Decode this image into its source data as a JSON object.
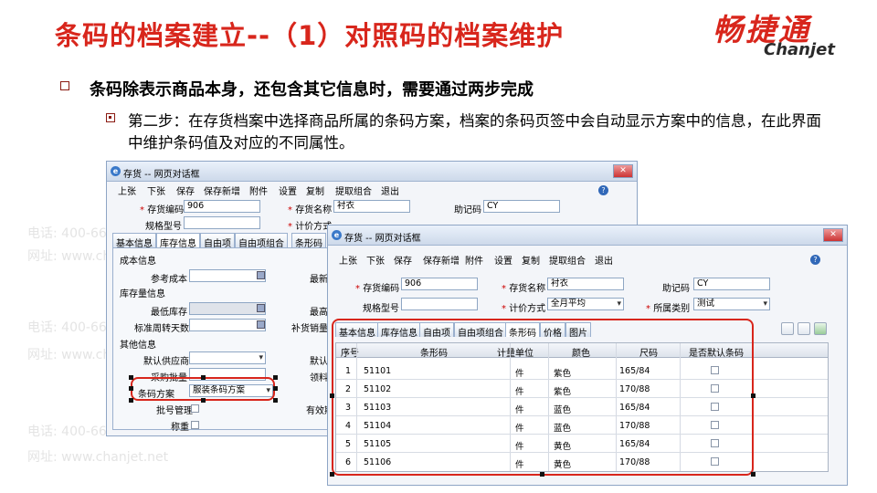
{
  "slide": {
    "title": "条码的档案建立--（1）对照码的档案维护",
    "bullet1": "条码除表示商品本身，还包含其它信息时，需要通过两步完成",
    "bullet2": "第二步：在存货档案中选择商品所属的条码方案，档案的条码页签中会自动显示方案中的信息，在此界面中维护条码值及对应的不同属性。"
  },
  "logo": {
    "cn": "畅捷通",
    "en": "Chanjet"
  },
  "watermark": {
    "phone": "电话: 400-665-0028",
    "web": "网址: www.chanjet.net"
  },
  "colors": {
    "accent": "#d8261c",
    "window_border": "#8ea5c5"
  },
  "back_window": {
    "title": "存货 -- 网页对话框",
    "menu": [
      "上张",
      "下张",
      "保存",
      "保存新增",
      "附件",
      "设置",
      "复制",
      "提取组合",
      "退出"
    ],
    "fields": {
      "code_label": "存货编码",
      "code_value": "906",
      "name_label": "存货名称",
      "name_value": "衬衣",
      "mnemonic_label": "助记码",
      "mnemonic_value": "CY",
      "spec_label": "规格型号",
      "unit_label": "计价方式"
    },
    "tabs": [
      "基本信息",
      "库存信息",
      "自由项",
      "自由项组合",
      "条形码"
    ],
    "sections": {
      "cost": "成本信息",
      "stock": "库存量信息",
      "other": "其他信息"
    },
    "labels": {
      "ref_cost": "参考成本",
      "latest": "最新",
      "min_stock": "最低库存",
      "max": "最高",
      "turnover": "标准周转天数",
      "supplement": "补货销量",
      "supplier": "默认供应商",
      "default_wh": "默认",
      "purchase_batch": "采购批量",
      "lead": "领料",
      "barcode_scheme": "条码方案",
      "barcode_scheme_value": "服装条码方案",
      "batch_mgmt": "批号管理",
      "expiry": "有效期",
      "weighing": "称重"
    }
  },
  "front_window": {
    "title": "存货 -- 网页对话框",
    "menu": [
      "上张",
      "下张",
      "保存",
      "保存新增",
      "附件",
      "设置",
      "复制",
      "提取组合",
      "退出"
    ],
    "fields": {
      "code_label": "存货编码",
      "code_value": "906",
      "name_label": "存货名称",
      "name_value": "衬衣",
      "mnemonic_label": "助记码",
      "mnemonic_value": "CY",
      "spec_label": "规格型号",
      "pricing_label": "计价方式",
      "pricing_value": "全月平均",
      "category_label": "所属类别",
      "category_value": "测试"
    },
    "tabs": [
      "基本信息",
      "库存信息",
      "自由项",
      "自由项组合",
      "条形码",
      "价格",
      "图片"
    ],
    "table": {
      "columns": [
        "序号",
        "条形码",
        "计量单位",
        "颜色",
        "尺码",
        "是否默认条码"
      ],
      "rows": [
        {
          "no": "1",
          "barcode": "51101",
          "unit": "件",
          "color": "紫色",
          "size": "165/84",
          "default": false
        },
        {
          "no": "2",
          "barcode": "51102",
          "unit": "件",
          "color": "紫色",
          "size": "170/88",
          "default": false
        },
        {
          "no": "3",
          "barcode": "51103",
          "unit": "件",
          "color": "蓝色",
          "size": "165/84",
          "default": false
        },
        {
          "no": "4",
          "barcode": "51104",
          "unit": "件",
          "color": "蓝色",
          "size": "170/88",
          "default": false
        },
        {
          "no": "5",
          "barcode": "51105",
          "unit": "件",
          "color": "黄色",
          "size": "165/84",
          "default": false
        },
        {
          "no": "6",
          "barcode": "51106",
          "unit": "件",
          "color": "黄色",
          "size": "170/88",
          "default": false
        }
      ]
    }
  }
}
